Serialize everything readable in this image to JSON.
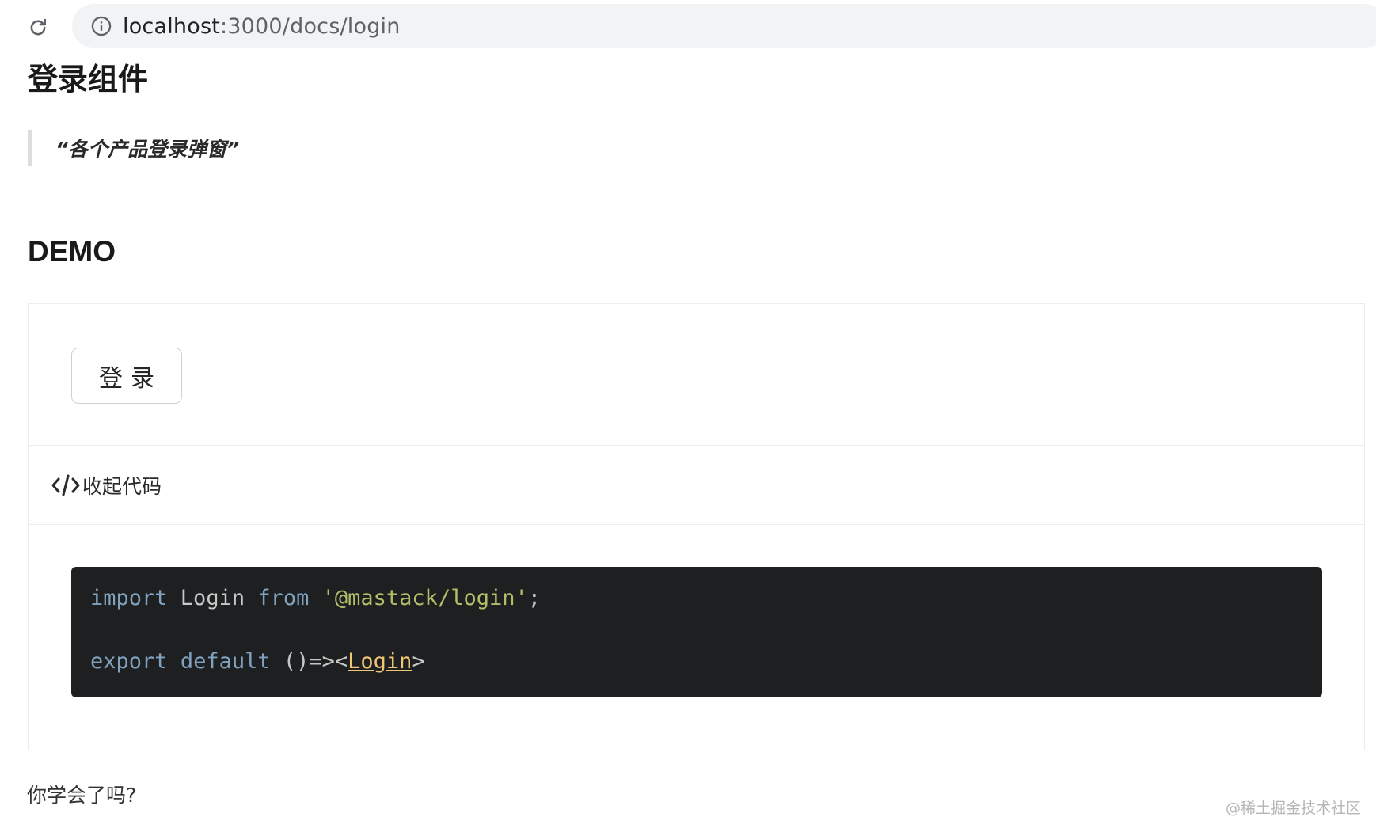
{
  "browser": {
    "url_host": "localhost",
    "url_rest": ":3000/docs/login",
    "reload_icon": "reload-icon",
    "info_icon": "info-icon"
  },
  "page": {
    "title": "登录组件",
    "quote": "“各个产品登录弹窗”",
    "section_heading": "DEMO"
  },
  "demo": {
    "login_button_label": "登录",
    "toggle_icon": "code-icon",
    "toggle_label": "收起代码",
    "code": {
      "line1": {
        "kw1": "import",
        "name": " Login ",
        "kw2": "from",
        "space": " ",
        "str": "'@mastack/login'",
        "end": ";"
      },
      "line2": {
        "kw1": "export",
        "space1": " ",
        "kw2": "default",
        "punc1": " ()=><",
        "tag": "Login",
        "punc2": ">"
      }
    }
  },
  "footer": {
    "question": "你学会了吗?",
    "watermark": "@稀土掘金技术社区"
  },
  "colors": {
    "code_bg": "#1d1f21",
    "keyword": "#81a2be",
    "string": "#b5bd68",
    "tag": "#f0c674"
  }
}
